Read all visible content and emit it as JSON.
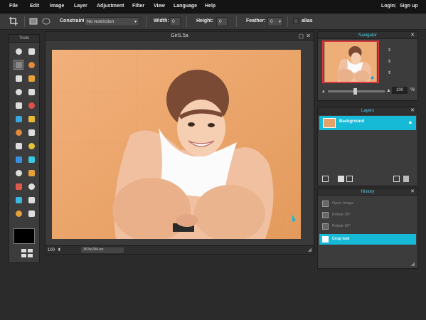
{
  "menubar": {
    "items": [
      "File",
      "Edit",
      "Image",
      "Layer",
      "Adjustment",
      "Filter",
      "View",
      "Language",
      "Help"
    ],
    "login_label": "Login",
    "signup_label": "Sign up"
  },
  "options": {
    "constraint_label": "Constraint:",
    "constraint_value": "No restriction",
    "width_label": "Width:",
    "width_value": "0",
    "height_label": "Height:",
    "height_value": "0",
    "feather_label": "Feather:",
    "feather_value": "0",
    "antialias_label": "alias"
  },
  "tools": {
    "title": "Tools",
    "icons": [
      "crop-icon",
      "move-icon",
      "marquee-icon",
      "lasso-icon",
      "wand-icon",
      "pencil-icon",
      "brush-icon",
      "clone-icon",
      "eraser-icon",
      "stamp-icon",
      "bucket-icon",
      "gradient-icon",
      "heal-icon",
      "blur-icon",
      "sharpen-icon",
      "smudge-icon",
      "sponge-icon",
      "dodge-icon",
      "burn-icon",
      "redeye-icon",
      "drop-icon",
      "shape-icon",
      "dropper-icon",
      "text-icon",
      "hand-icon",
      "zoom-icon"
    ]
  },
  "document": {
    "title": "Girl1.5a",
    "zoom": "100",
    "dimensions": "363x294 px"
  },
  "navigator": {
    "title": "Navigator",
    "zoom": "100"
  },
  "layers": {
    "title": "Layers",
    "items": [
      {
        "name": "Background"
      }
    ]
  },
  "history": {
    "title": "History",
    "items": [
      {
        "label": "Open Image",
        "active": false
      },
      {
        "label": "Rotate 90°",
        "active": false
      },
      {
        "label": "Rotate 90°",
        "active": false
      },
      {
        "label": "Crop tool",
        "active": true
      }
    ]
  },
  "colors": {
    "accent": "#16b9d6",
    "background": "#2b2b2b",
    "panel": "#3c3c3c"
  }
}
